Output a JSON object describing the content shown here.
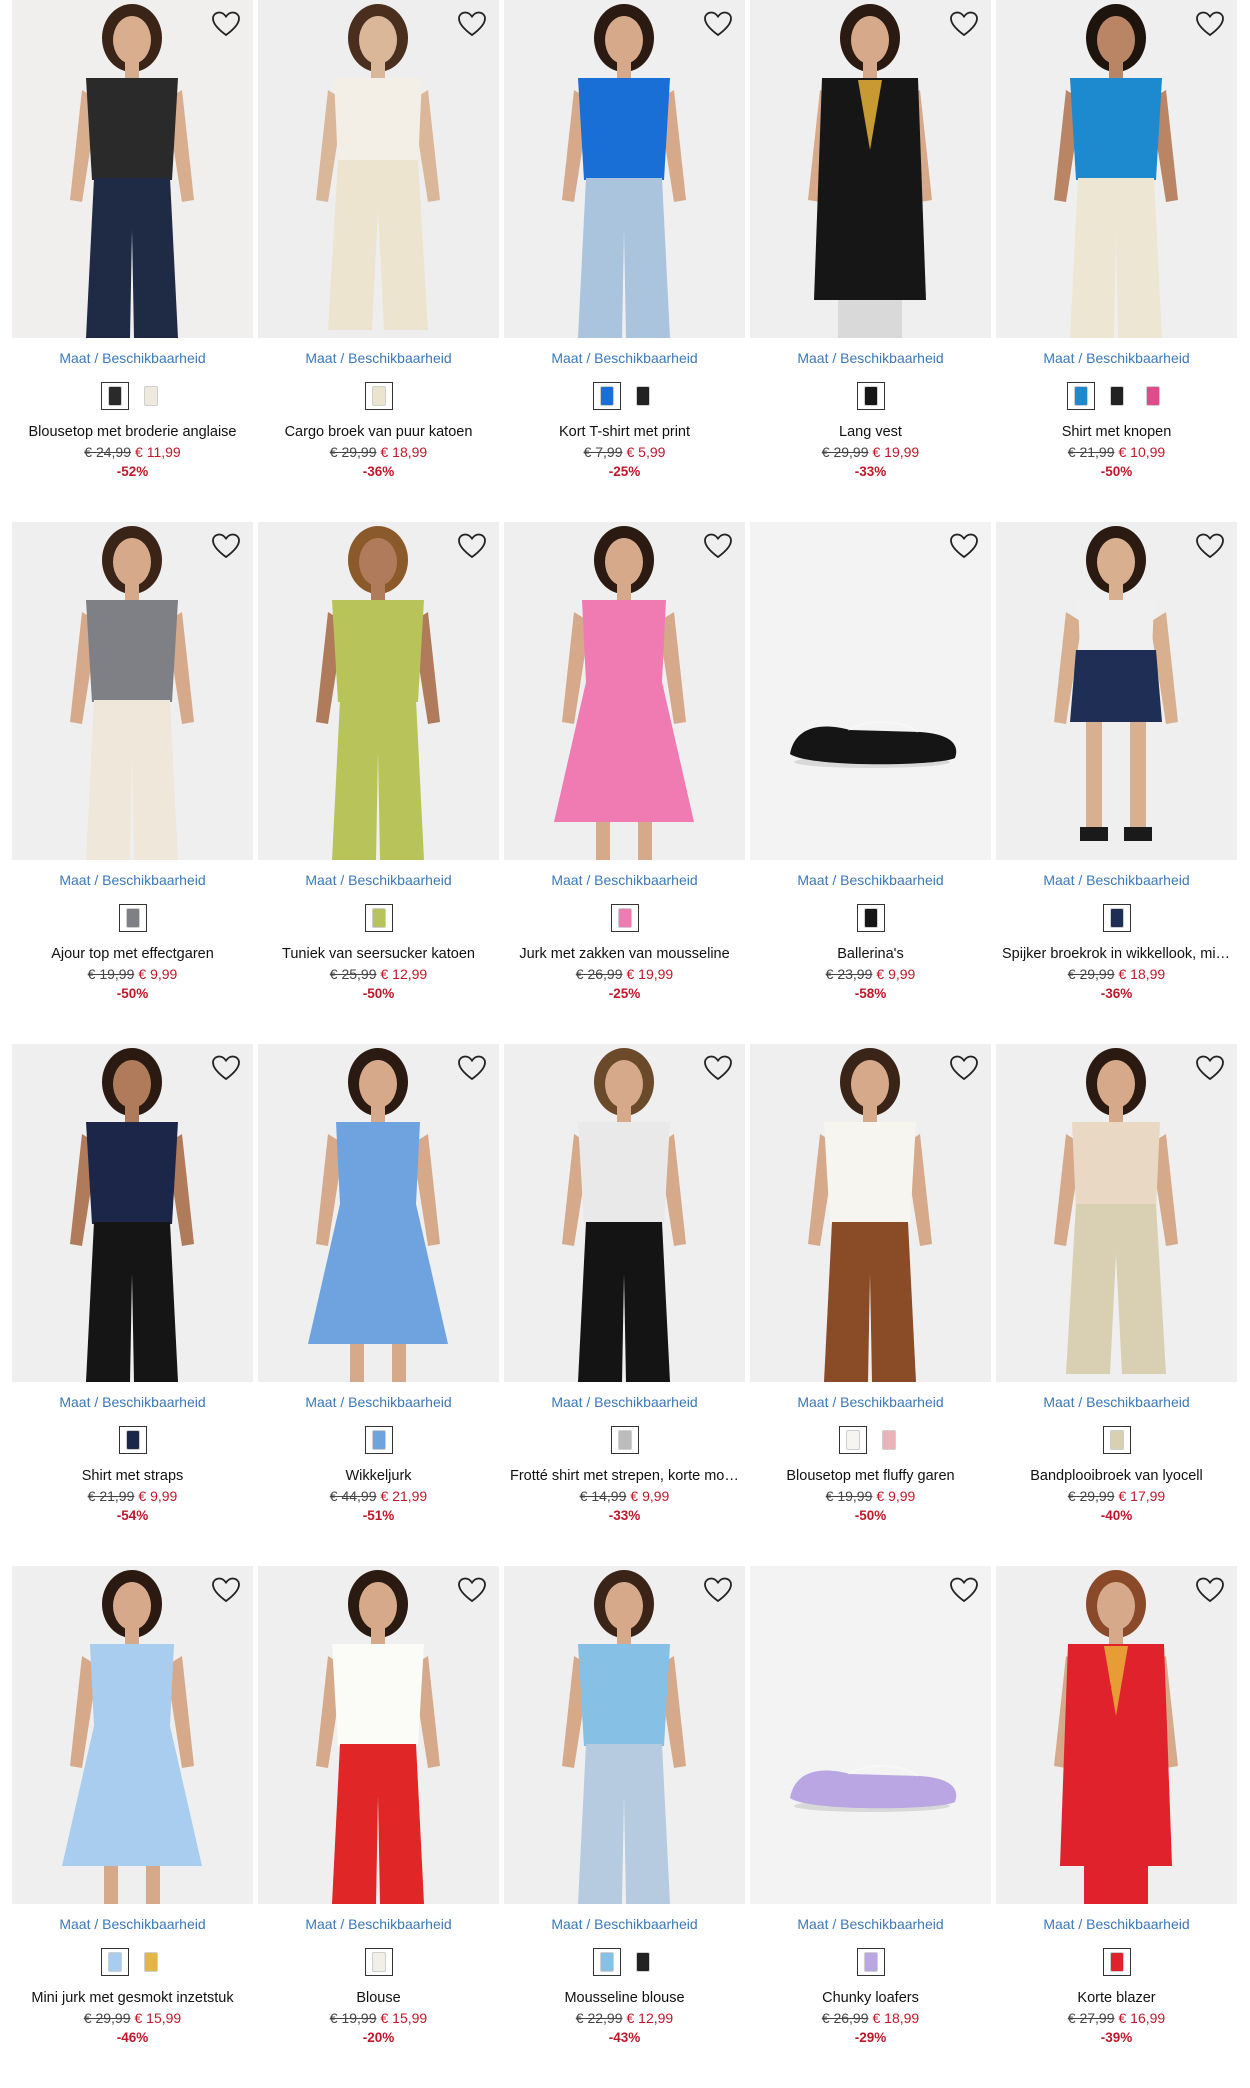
{
  "size_link_label": "Maat / Beschikbaarheid",
  "colors": {
    "price_new": "#c0182a",
    "link": "#3b78b8"
  },
  "products": [
    {
      "name": "Blousetop met broderie anglaise",
      "old_price": "€ 24,99",
      "new_price": "€ 11,99",
      "discount": "-52%",
      "bg": "#f1eeee",
      "garment": "#2a2a2a",
      "lower": "#1f2a44",
      "skin": "#d9ae8e",
      "hair": "#3a2418",
      "kind": "top",
      "swatches": [
        "#2a2a2a",
        "#efe8dc"
      ]
    },
    {
      "name": "Cargo broek van puur katoen",
      "old_price": "€ 29,99",
      "new_price": "€ 18,99",
      "discount": "-36%",
      "bg": "#eeeeee",
      "garment": "#f4efe6",
      "lower": "#ece4cf",
      "skin": "#dbb79a",
      "hair": "#4a2f1f",
      "kind": "pants",
      "swatches": [
        "#ece4cf"
      ]
    },
    {
      "name": "Kort T-shirt met print",
      "old_price": "€ 7,99",
      "new_price": "€ 5,99",
      "discount": "-25%",
      "bg": "#efefef",
      "garment": "#1a6fd6",
      "lower": "#a9c4dc",
      "skin": "#d6a98a",
      "hair": "#2b1a12",
      "kind": "top",
      "swatches": [
        "#1a6fd6",
        "#222222"
      ]
    },
    {
      "name": "Lang vest",
      "old_price": "€ 29,99",
      "new_price": "€ 19,99",
      "discount": "-33%",
      "bg": "#efefef",
      "garment": "#161616",
      "lower": "#d9d9d9",
      "skin": "#d6a98a",
      "hair": "#2b1a12",
      "kind": "coat",
      "swatches": [
        "#161616"
      ]
    },
    {
      "name": "Shirt met knopen",
      "old_price": "€ 21,99",
      "new_price": "€ 10,99",
      "discount": "-50%",
      "bg": "#efefef",
      "garment": "#1d8ad0",
      "lower": "#ede6d3",
      "skin": "#b98565",
      "hair": "#1e140e",
      "kind": "top",
      "swatches": [
        "#1d8ad0",
        "#222222",
        "#e24a8a"
      ]
    },
    {
      "name": "Ajour top met effectgaren",
      "old_price": "€ 19,99",
      "new_price": "€ 9,99",
      "discount": "-50%",
      "bg": "#efefef",
      "garment": "#7e8086",
      "lower": "#efe7da",
      "skin": "#d6a98a",
      "hair": "#3a2418",
      "kind": "top",
      "swatches": [
        "#7e8086"
      ]
    },
    {
      "name": "Tuniek van seersucker katoen",
      "old_price": "€ 25,99",
      "new_price": "€ 12,99",
      "discount": "-50%",
      "bg": "#efefef",
      "garment": "#b8c45a",
      "lower": "#b8c45a",
      "skin": "#b07b5a",
      "hair": "#8a5a2a",
      "kind": "top",
      "swatches": [
        "#b8c45a"
      ]
    },
    {
      "name": "Jurk met zakken van mousseline",
      "old_price": "€ 26,99",
      "new_price": "€ 19,99",
      "discount": "-25%",
      "bg": "#efefef",
      "garment": "#f07bb3",
      "lower": "#f07bb3",
      "skin": "#d6a98a",
      "hair": "#2b1a12",
      "kind": "dress",
      "swatches": [
        "#f07bb3"
      ]
    },
    {
      "name": "Ballerina's",
      "old_price": "€ 23,99",
      "new_price": "€ 9,99",
      "discount": "-58%",
      "bg": "#f3f3f3",
      "garment": "#151515",
      "lower": "#151515",
      "skin": "#000000",
      "hair": "#000000",
      "kind": "shoe",
      "swatches": [
        "#151515"
      ]
    },
    {
      "name": "Spijker broekrok in wikkellook, mini lengte",
      "old_price": "€ 29,99",
      "new_price": "€ 18,99",
      "discount": "-36%",
      "bg": "#efefef",
      "garment": "#1e2e55",
      "lower": "#1e2e55",
      "skin": "#d8b090",
      "hair": "#2b1a12",
      "kind": "skirt",
      "swatches": [
        "#1e2e55"
      ]
    },
    {
      "name": "Shirt met straps",
      "old_price": "€ 21,99",
      "new_price": "€ 9,99",
      "discount": "-54%",
      "bg": "#efefef",
      "garment": "#1c2649",
      "lower": "#151515",
      "skin": "#b07b5a",
      "hair": "#2b1a12",
      "kind": "top",
      "swatches": [
        "#1c2649"
      ]
    },
    {
      "name": "Wikkeljurk",
      "old_price": "€ 44,99",
      "new_price": "€ 21,99",
      "discount": "-51%",
      "bg": "#efefef",
      "garment": "#6fa3e0",
      "lower": "#6fa3e0",
      "skin": "#d6a98a",
      "hair": "#2b1a12",
      "kind": "dress",
      "swatches": [
        "#6fa3e0"
      ]
    },
    {
      "name": "Frotté shirt met strepen, korte mouw",
      "old_price": "€ 14,99",
      "new_price": "€ 9,99",
      "discount": "-33%",
      "bg": "#efefef",
      "garment": "#e9e9e9",
      "lower": "#141414",
      "skin": "#d6a98a",
      "hair": "#6a4a2a",
      "kind": "top",
      "swatches": [
        "#bcbcbc"
      ]
    },
    {
      "name": "Blousetop met fluffy garen",
      "old_price": "€ 19,99",
      "new_price": "€ 9,99",
      "discount": "-50%",
      "bg": "#efefef",
      "garment": "#f7f5ef",
      "lower": "#8a4b27",
      "skin": "#d6a98a",
      "hair": "#3a2418",
      "kind": "top",
      "swatches": [
        "#f7f5ef",
        "#eab3b8"
      ]
    },
    {
      "name": "Bandplooibroek van lyocell",
      "old_price": "€ 29,99",
      "new_price": "€ 17,99",
      "discount": "-40%",
      "bg": "#efefef",
      "garment": "#e9d9c4",
      "lower": "#d9cfb3",
      "skin": "#d6a98a",
      "hair": "#2b1a12",
      "kind": "pants",
      "swatches": [
        "#d9cfb3"
      ]
    },
    {
      "name": "Mini jurk met gesmokt inzetstuk",
      "old_price": "€ 29,99",
      "new_price": "€ 15,99",
      "discount": "-46%",
      "bg": "#efefef",
      "garment": "#a9cdee",
      "lower": "#a9cdee",
      "skin": "#d6a98a",
      "hair": "#2b1a12",
      "kind": "dress",
      "swatches": [
        "#a9cdee",
        "#e2b64a"
      ]
    },
    {
      "name": "Blouse",
      "old_price": "€ 19,99",
      "new_price": "€ 15,99",
      "discount": "-20%",
      "bg": "#efefef",
      "garment": "#fbfbf8",
      "lower": "#e02626",
      "skin": "#d6a98a",
      "hair": "#2b1a12",
      "kind": "top",
      "swatches": [
        "#f2efe6"
      ]
    },
    {
      "name": "Mousseline blouse",
      "old_price": "€ 22,99",
      "new_price": "€ 12,99",
      "discount": "-43%",
      "bg": "#efefef",
      "garment": "#86c0e4",
      "lower": "#b7cbe0",
      "skin": "#d6a98a",
      "hair": "#3a2418",
      "kind": "top",
      "swatches": [
        "#86c0e4",
        "#222222"
      ]
    },
    {
      "name": "Chunky loafers",
      "old_price": "€ 26,99",
      "new_price": "€ 18,99",
      "discount": "-29%",
      "bg": "#f3f3f3",
      "garment": "#b9a6e2",
      "lower": "#b9a6e2",
      "skin": "#000000",
      "hair": "#000000",
      "kind": "shoe",
      "swatches": [
        "#b9a6e2"
      ]
    },
    {
      "name": "Korte blazer",
      "old_price": "€ 27,99",
      "new_price": "€ 16,99",
      "discount": "-39%",
      "bg": "#efefef",
      "garment": "#e0222c",
      "lower": "#e0222c",
      "skin": "#d6a98a",
      "hair": "#8a4a2a",
      "kind": "coat",
      "swatches": [
        "#e0222c"
      ]
    }
  ]
}
